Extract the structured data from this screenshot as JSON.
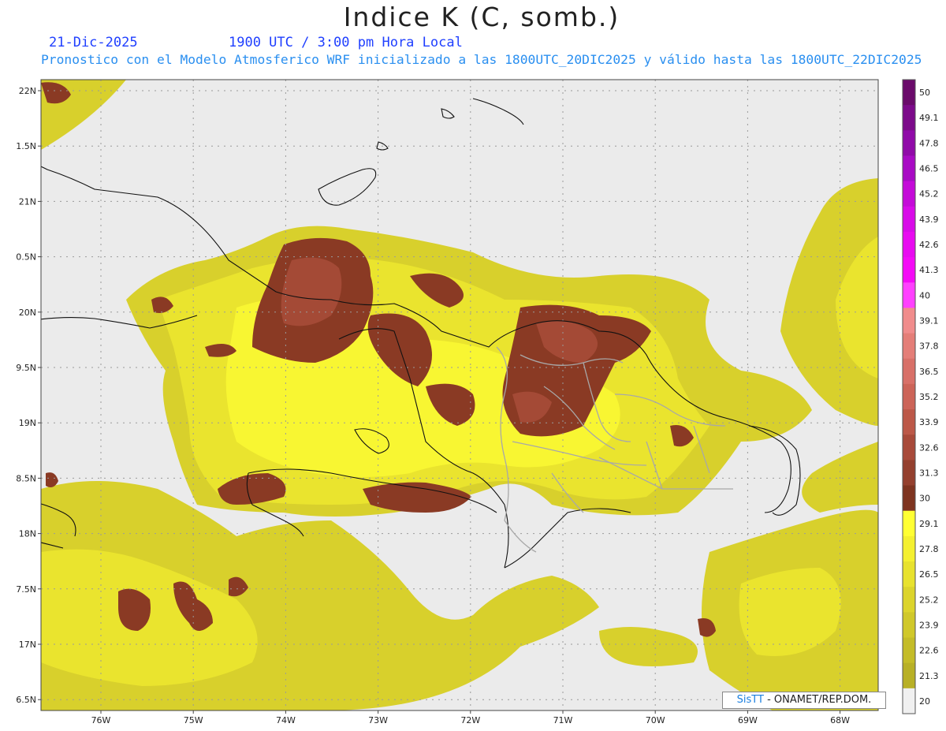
{
  "header": {
    "title": "Indice K (C, somb.)",
    "date": "21-Dic-2025",
    "time": "1900 UTC / 3:00 pm Hora Local",
    "description": "Pronostico con el Modelo Atmosferico WRF inicializado a las 1800UTC_20DIC2025 y válido hasta las  1800UTC_22DIC2025"
  },
  "map": {
    "lon_labels": [
      "76W",
      "75W",
      "74W",
      "73W",
      "72W",
      "71W",
      "70W",
      "69W",
      "68W"
    ],
    "lat_labels": [
      "22N",
      "1.5N",
      "21N",
      "0.5N",
      "20N",
      "9.5N",
      "19N",
      "8.5N",
      "18N",
      "7.5N",
      "17N",
      "6.5N"
    ],
    "background_color": "#ebebeb"
  },
  "colorbar": {
    "labels": [
      "50",
      "49.1",
      "47.8",
      "46.5",
      "45.2",
      "43.9",
      "42.6",
      "41.3",
      "40",
      "39.1",
      "37.8",
      "36.5",
      "35.2",
      "33.9",
      "32.6",
      "31.3",
      "30",
      "29.1",
      "27.8",
      "26.5",
      "25.2",
      "23.9",
      "22.6",
      "21.3",
      "20"
    ],
    "colors": [
      "#6a0a6a",
      "#7c0a8a",
      "#900aa8",
      "#a80ac4",
      "#c40ad8",
      "#d80ae8",
      "#e80af0",
      "#f40af6",
      "#ff40ff",
      "#f08c8c",
      "#e47e78",
      "#d87068",
      "#cc6458",
      "#bc5848",
      "#a84a3a",
      "#94402e",
      "#7e3420",
      "#ffff33",
      "#f4f030",
      "#e8e22e",
      "#dcd42c",
      "#d0c82a",
      "#c4bc28",
      "#b8b026",
      "#f0f0f0"
    ]
  },
  "credit": {
    "brand": "SisTT",
    "text": " - ONAMET/REP.DOM."
  }
}
